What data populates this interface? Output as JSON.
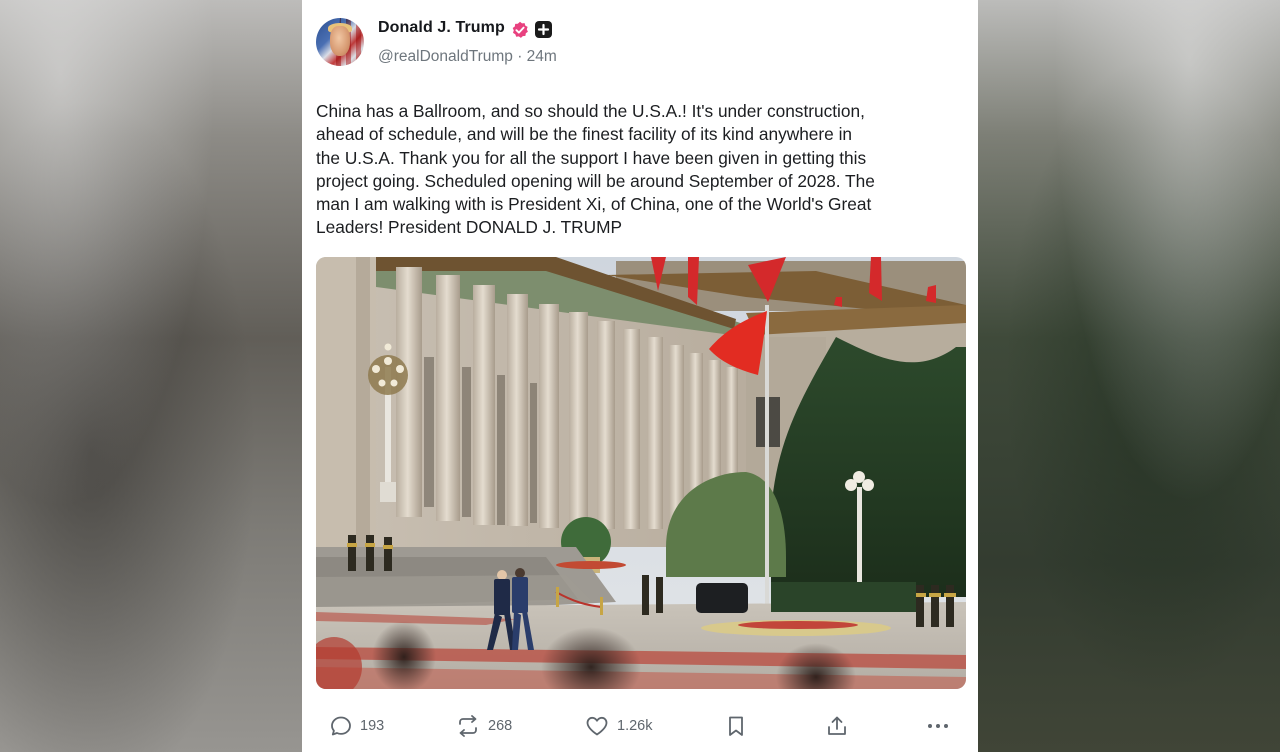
{
  "post": {
    "author_name": "Donald J. Trump",
    "handle_time": "@realDonaldTrump · 24m",
    "text": "China has a Ballroom, and so should the U.S.A.! It's under construction,\nahead of schedule, and will be the finest facility of its kind anywhere in\nthe U.S.A. Thank you for all the support I have been given in getting this\nproject going. Scheduled opening will be around September of 2028. The\nman I am walking with is President Xi, of China, one of the World's Great\nLeaders! President DONALD J. TRUMP",
    "verified_color": "#e8417f",
    "icons": {
      "verified": "verified-badge-icon",
      "plus": "plus-badge-icon"
    }
  },
  "actions": {
    "replies": "193",
    "reposts": "268",
    "likes": "1.26k",
    "icons": [
      "reply-icon",
      "repost-icon",
      "like-icon",
      "bookmark-icon",
      "share-icon",
      "more-icon"
    ]
  }
}
